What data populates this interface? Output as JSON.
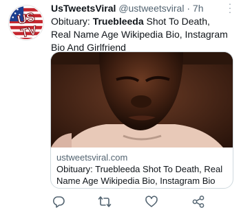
{
  "tweet": {
    "display_name": "UsTweetsViral",
    "handle": "@ustweetsviral",
    "separator": "·",
    "time_ago": "7h",
    "text_prefix": "Obituary: ",
    "text_bold": "Truebleeda",
    "text_rest": " Shot To Death, Real Name Age Wikipedia Bio, Instagram Bio And Girlfriend",
    "avatar_text": "US TV"
  },
  "card": {
    "domain": "ustweetsviral.com",
    "title": "Obituary: Truebleeda Shot To Death, Real Name Age Wikipedia Bio, Instagram Bio An..."
  },
  "actions": [
    {
      "icon": "reply-icon"
    },
    {
      "icon": "retweet-icon"
    },
    {
      "icon": "like-icon"
    },
    {
      "icon": "share-icon"
    }
  ],
  "colors": {
    "text": "#0f1419",
    "secondary": "#536471",
    "border": "#cfd9de",
    "icon": "#536471"
  }
}
